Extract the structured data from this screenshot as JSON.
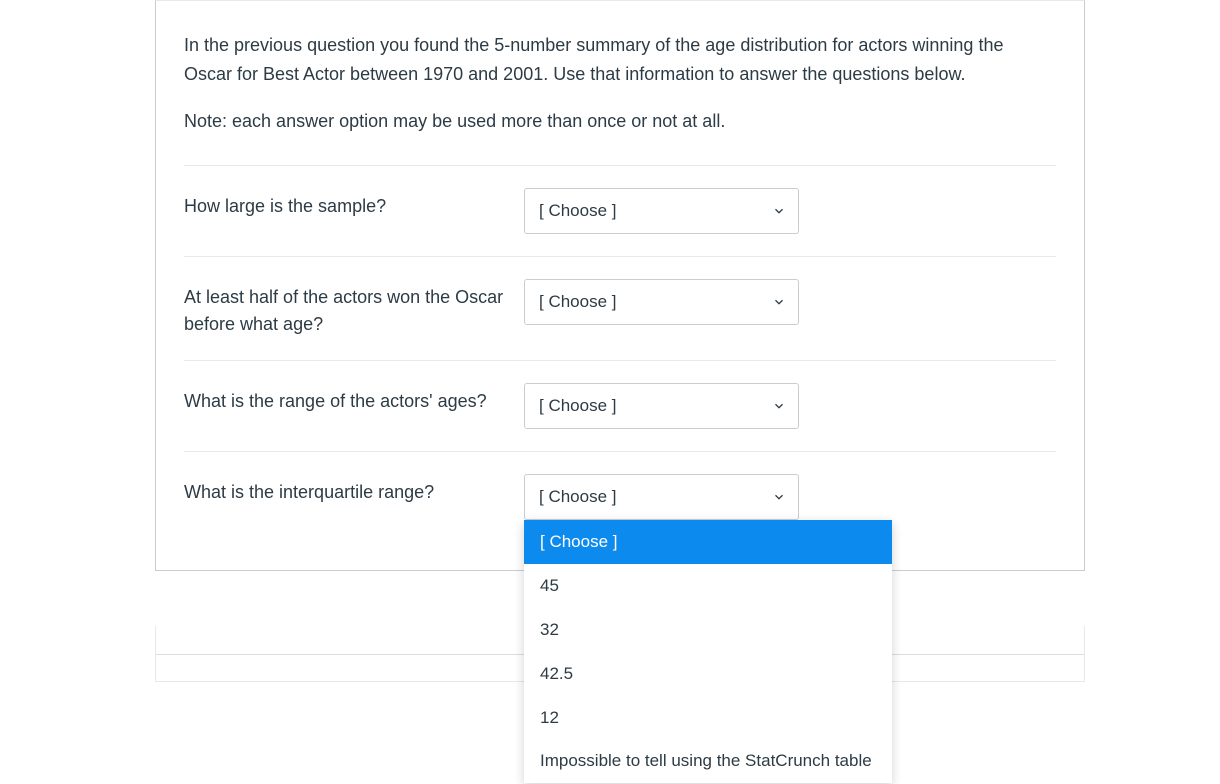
{
  "prompt": "In the previous question you found the 5-number summary of the age distribution for actors winning the Oscar for Best Actor between 1970 and 2001. Use that information to answer the questions below.",
  "note": "Note: each answer option may be used more than once or not at all.",
  "choose_placeholder": "[ Choose ]",
  "questions": [
    {
      "label": "How large is the sample?"
    },
    {
      "label": "At least half of the actors won the Oscar before what age?"
    },
    {
      "label": "What is the range of the actors' ages?"
    },
    {
      "label": "What is the interquartile range?"
    }
  ],
  "dropdown_options": [
    "[ Choose ]",
    "45",
    "32",
    "42.5",
    "12",
    "Impossible to tell using the StatCrunch table"
  ]
}
